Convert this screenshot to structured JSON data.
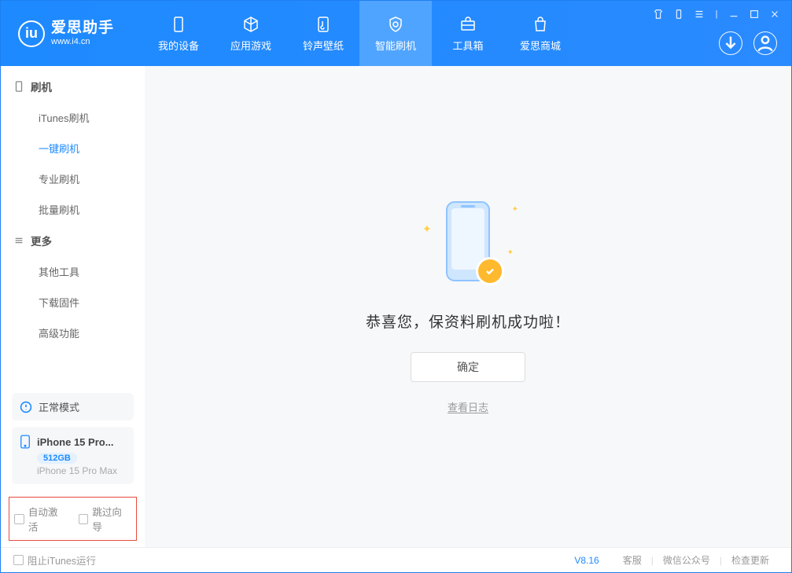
{
  "app": {
    "title": "爱思助手",
    "url": "www.i4.cn"
  },
  "nav": {
    "items": [
      {
        "label": "我的设备"
      },
      {
        "label": "应用游戏"
      },
      {
        "label": "铃声壁纸"
      },
      {
        "label": "智能刷机"
      },
      {
        "label": "工具箱"
      },
      {
        "label": "爱思商城"
      }
    ]
  },
  "sidebar": {
    "section1": {
      "title": "刷机",
      "items": [
        "iTunes刷机",
        "一键刷机",
        "专业刷机",
        "批量刷机"
      ]
    },
    "section2": {
      "title": "更多",
      "items": [
        "其他工具",
        "下载固件",
        "高级功能"
      ]
    },
    "mode": "正常模式",
    "device": {
      "name": "iPhone 15 Pro...",
      "storage": "512GB",
      "full": "iPhone 15 Pro Max"
    },
    "options": {
      "auto_activate": "自动激活",
      "skip_guide": "跳过向导"
    }
  },
  "main": {
    "message": "恭喜您，保资料刷机成功啦！",
    "ok": "确定",
    "log": "查看日志"
  },
  "footer": {
    "block_itunes": "阻止iTunes运行",
    "version": "V8.16",
    "links": [
      "客服",
      "微信公众号",
      "检查更新"
    ]
  }
}
